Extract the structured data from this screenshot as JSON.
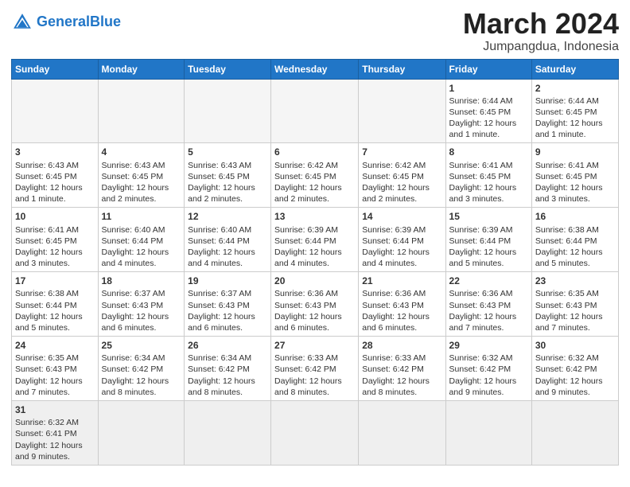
{
  "header": {
    "logo_general": "General",
    "logo_blue": "Blue",
    "title": "March 2024",
    "subtitle": "Jumpangdua, Indonesia"
  },
  "weekdays": [
    "Sunday",
    "Monday",
    "Tuesday",
    "Wednesday",
    "Thursday",
    "Friday",
    "Saturday"
  ],
  "weeks": [
    [
      {
        "day": "",
        "info": ""
      },
      {
        "day": "",
        "info": ""
      },
      {
        "day": "",
        "info": ""
      },
      {
        "day": "",
        "info": ""
      },
      {
        "day": "",
        "info": ""
      },
      {
        "day": "1",
        "info": "Sunrise: 6:44 AM\nSunset: 6:45 PM\nDaylight: 12 hours and 1 minute."
      },
      {
        "day": "2",
        "info": "Sunrise: 6:44 AM\nSunset: 6:45 PM\nDaylight: 12 hours and 1 minute."
      }
    ],
    [
      {
        "day": "3",
        "info": "Sunrise: 6:43 AM\nSunset: 6:45 PM\nDaylight: 12 hours and 1 minute."
      },
      {
        "day": "4",
        "info": "Sunrise: 6:43 AM\nSunset: 6:45 PM\nDaylight: 12 hours and 2 minutes."
      },
      {
        "day": "5",
        "info": "Sunrise: 6:43 AM\nSunset: 6:45 PM\nDaylight: 12 hours and 2 minutes."
      },
      {
        "day": "6",
        "info": "Sunrise: 6:42 AM\nSunset: 6:45 PM\nDaylight: 12 hours and 2 minutes."
      },
      {
        "day": "7",
        "info": "Sunrise: 6:42 AM\nSunset: 6:45 PM\nDaylight: 12 hours and 2 minutes."
      },
      {
        "day": "8",
        "info": "Sunrise: 6:41 AM\nSunset: 6:45 PM\nDaylight: 12 hours and 3 minutes."
      },
      {
        "day": "9",
        "info": "Sunrise: 6:41 AM\nSunset: 6:45 PM\nDaylight: 12 hours and 3 minutes."
      }
    ],
    [
      {
        "day": "10",
        "info": "Sunrise: 6:41 AM\nSunset: 6:45 PM\nDaylight: 12 hours and 3 minutes."
      },
      {
        "day": "11",
        "info": "Sunrise: 6:40 AM\nSunset: 6:44 PM\nDaylight: 12 hours and 4 minutes."
      },
      {
        "day": "12",
        "info": "Sunrise: 6:40 AM\nSunset: 6:44 PM\nDaylight: 12 hours and 4 minutes."
      },
      {
        "day": "13",
        "info": "Sunrise: 6:39 AM\nSunset: 6:44 PM\nDaylight: 12 hours and 4 minutes."
      },
      {
        "day": "14",
        "info": "Sunrise: 6:39 AM\nSunset: 6:44 PM\nDaylight: 12 hours and 4 minutes."
      },
      {
        "day": "15",
        "info": "Sunrise: 6:39 AM\nSunset: 6:44 PM\nDaylight: 12 hours and 5 minutes."
      },
      {
        "day": "16",
        "info": "Sunrise: 6:38 AM\nSunset: 6:44 PM\nDaylight: 12 hours and 5 minutes."
      }
    ],
    [
      {
        "day": "17",
        "info": "Sunrise: 6:38 AM\nSunset: 6:44 PM\nDaylight: 12 hours and 5 minutes."
      },
      {
        "day": "18",
        "info": "Sunrise: 6:37 AM\nSunset: 6:43 PM\nDaylight: 12 hours and 6 minutes."
      },
      {
        "day": "19",
        "info": "Sunrise: 6:37 AM\nSunset: 6:43 PM\nDaylight: 12 hours and 6 minutes."
      },
      {
        "day": "20",
        "info": "Sunrise: 6:36 AM\nSunset: 6:43 PM\nDaylight: 12 hours and 6 minutes."
      },
      {
        "day": "21",
        "info": "Sunrise: 6:36 AM\nSunset: 6:43 PM\nDaylight: 12 hours and 6 minutes."
      },
      {
        "day": "22",
        "info": "Sunrise: 6:36 AM\nSunset: 6:43 PM\nDaylight: 12 hours and 7 minutes."
      },
      {
        "day": "23",
        "info": "Sunrise: 6:35 AM\nSunset: 6:43 PM\nDaylight: 12 hours and 7 minutes."
      }
    ],
    [
      {
        "day": "24",
        "info": "Sunrise: 6:35 AM\nSunset: 6:43 PM\nDaylight: 12 hours and 7 minutes."
      },
      {
        "day": "25",
        "info": "Sunrise: 6:34 AM\nSunset: 6:42 PM\nDaylight: 12 hours and 8 minutes."
      },
      {
        "day": "26",
        "info": "Sunrise: 6:34 AM\nSunset: 6:42 PM\nDaylight: 12 hours and 8 minutes."
      },
      {
        "day": "27",
        "info": "Sunrise: 6:33 AM\nSunset: 6:42 PM\nDaylight: 12 hours and 8 minutes."
      },
      {
        "day": "28",
        "info": "Sunrise: 6:33 AM\nSunset: 6:42 PM\nDaylight: 12 hours and 8 minutes."
      },
      {
        "day": "29",
        "info": "Sunrise: 6:32 AM\nSunset: 6:42 PM\nDaylight: 12 hours and 9 minutes."
      },
      {
        "day": "30",
        "info": "Sunrise: 6:32 AM\nSunset: 6:42 PM\nDaylight: 12 hours and 9 minutes."
      }
    ],
    [
      {
        "day": "31",
        "info": "Sunrise: 6:32 AM\nSunset: 6:41 PM\nDaylight: 12 hours and 9 minutes."
      },
      {
        "day": "",
        "info": ""
      },
      {
        "day": "",
        "info": ""
      },
      {
        "day": "",
        "info": ""
      },
      {
        "day": "",
        "info": ""
      },
      {
        "day": "",
        "info": ""
      },
      {
        "day": "",
        "info": ""
      }
    ]
  ]
}
